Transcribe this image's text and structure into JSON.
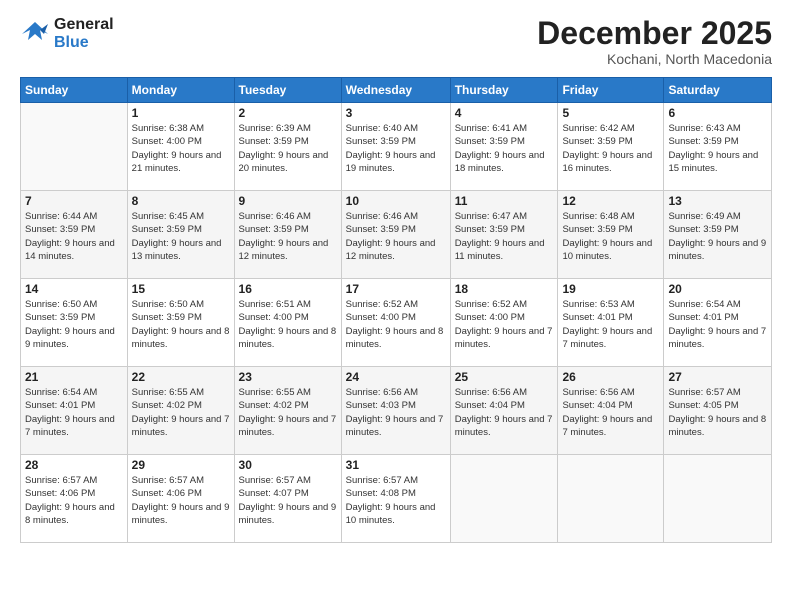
{
  "logo": {
    "line1": "General",
    "line2": "Blue"
  },
  "title": "December 2025",
  "location": "Kochani, North Macedonia",
  "days_of_week": [
    "Sunday",
    "Monday",
    "Tuesday",
    "Wednesday",
    "Thursday",
    "Friday",
    "Saturday"
  ],
  "weeks": [
    [
      {
        "day": "",
        "empty": true
      },
      {
        "day": "1",
        "sunrise": "6:38 AM",
        "sunset": "4:00 PM",
        "daylight": "9 hours and 21 minutes."
      },
      {
        "day": "2",
        "sunrise": "6:39 AM",
        "sunset": "3:59 PM",
        "daylight": "9 hours and 20 minutes."
      },
      {
        "day": "3",
        "sunrise": "6:40 AM",
        "sunset": "3:59 PM",
        "daylight": "9 hours and 19 minutes."
      },
      {
        "day": "4",
        "sunrise": "6:41 AM",
        "sunset": "3:59 PM",
        "daylight": "9 hours and 18 minutes."
      },
      {
        "day": "5",
        "sunrise": "6:42 AM",
        "sunset": "3:59 PM",
        "daylight": "9 hours and 16 minutes."
      },
      {
        "day": "6",
        "sunrise": "6:43 AM",
        "sunset": "3:59 PM",
        "daylight": "9 hours and 15 minutes."
      }
    ],
    [
      {
        "day": "7",
        "sunrise": "6:44 AM",
        "sunset": "3:59 PM",
        "daylight": "9 hours and 14 minutes."
      },
      {
        "day": "8",
        "sunrise": "6:45 AM",
        "sunset": "3:59 PM",
        "daylight": "9 hours and 13 minutes."
      },
      {
        "day": "9",
        "sunrise": "6:46 AM",
        "sunset": "3:59 PM",
        "daylight": "9 hours and 12 minutes."
      },
      {
        "day": "10",
        "sunrise": "6:46 AM",
        "sunset": "3:59 PM",
        "daylight": "9 hours and 12 minutes."
      },
      {
        "day": "11",
        "sunrise": "6:47 AM",
        "sunset": "3:59 PM",
        "daylight": "9 hours and 11 minutes."
      },
      {
        "day": "12",
        "sunrise": "6:48 AM",
        "sunset": "3:59 PM",
        "daylight": "9 hours and 10 minutes."
      },
      {
        "day": "13",
        "sunrise": "6:49 AM",
        "sunset": "3:59 PM",
        "daylight": "9 hours and 9 minutes."
      }
    ],
    [
      {
        "day": "14",
        "sunrise": "6:50 AM",
        "sunset": "3:59 PM",
        "daylight": "9 hours and 9 minutes."
      },
      {
        "day": "15",
        "sunrise": "6:50 AM",
        "sunset": "3:59 PM",
        "daylight": "9 hours and 8 minutes."
      },
      {
        "day": "16",
        "sunrise": "6:51 AM",
        "sunset": "4:00 PM",
        "daylight": "9 hours and 8 minutes."
      },
      {
        "day": "17",
        "sunrise": "6:52 AM",
        "sunset": "4:00 PM",
        "daylight": "9 hours and 8 minutes."
      },
      {
        "day": "18",
        "sunrise": "6:52 AM",
        "sunset": "4:00 PM",
        "daylight": "9 hours and 7 minutes."
      },
      {
        "day": "19",
        "sunrise": "6:53 AM",
        "sunset": "4:01 PM",
        "daylight": "9 hours and 7 minutes."
      },
      {
        "day": "20",
        "sunrise": "6:54 AM",
        "sunset": "4:01 PM",
        "daylight": "9 hours and 7 minutes."
      }
    ],
    [
      {
        "day": "21",
        "sunrise": "6:54 AM",
        "sunset": "4:01 PM",
        "daylight": "9 hours and 7 minutes."
      },
      {
        "day": "22",
        "sunrise": "6:55 AM",
        "sunset": "4:02 PM",
        "daylight": "9 hours and 7 minutes."
      },
      {
        "day": "23",
        "sunrise": "6:55 AM",
        "sunset": "4:02 PM",
        "daylight": "9 hours and 7 minutes."
      },
      {
        "day": "24",
        "sunrise": "6:56 AM",
        "sunset": "4:03 PM",
        "daylight": "9 hours and 7 minutes."
      },
      {
        "day": "25",
        "sunrise": "6:56 AM",
        "sunset": "4:04 PM",
        "daylight": "9 hours and 7 minutes."
      },
      {
        "day": "26",
        "sunrise": "6:56 AM",
        "sunset": "4:04 PM",
        "daylight": "9 hours and 7 minutes."
      },
      {
        "day": "27",
        "sunrise": "6:57 AM",
        "sunset": "4:05 PM",
        "daylight": "9 hours and 8 minutes."
      }
    ],
    [
      {
        "day": "28",
        "sunrise": "6:57 AM",
        "sunset": "4:06 PM",
        "daylight": "9 hours and 8 minutes."
      },
      {
        "day": "29",
        "sunrise": "6:57 AM",
        "sunset": "4:06 PM",
        "daylight": "9 hours and 9 minutes."
      },
      {
        "day": "30",
        "sunrise": "6:57 AM",
        "sunset": "4:07 PM",
        "daylight": "9 hours and 9 minutes."
      },
      {
        "day": "31",
        "sunrise": "6:57 AM",
        "sunset": "4:08 PM",
        "daylight": "9 hours and 10 minutes."
      },
      {
        "day": "",
        "empty": true
      },
      {
        "day": "",
        "empty": true
      },
      {
        "day": "",
        "empty": true
      }
    ]
  ]
}
